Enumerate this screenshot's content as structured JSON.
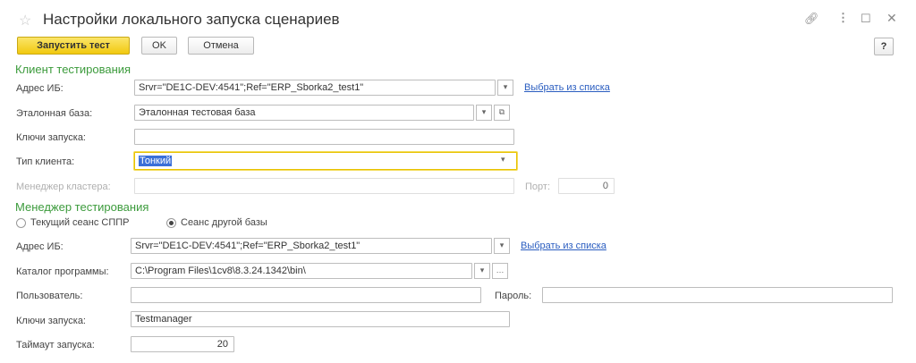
{
  "window": {
    "title": "Настройки локального запуска сценариев",
    "help_label": "?"
  },
  "toolbar": {
    "run_label": "Запустить тест",
    "ok_label": "OK",
    "cancel_label": "Отмена"
  },
  "client": {
    "section_title": "Клиент тестирования",
    "ib_address_label": "Адрес ИБ:",
    "ib_address_value": "Srvr=\"DE1C-DEV:4541\";Ref=\"ERP_Sborka2_test1\"",
    "select_from_list": "Выбрать из списка",
    "reference_base_label": "Эталонная база:",
    "reference_base_value": "Эталонная тестовая база",
    "launch_keys_label": "Ключи запуска:",
    "launch_keys_value": "",
    "client_type_label": "Тип клиента:",
    "client_type_value": "Тонкий",
    "cluster_manager_label": "Менеджер кластера:",
    "cluster_manager_value": "",
    "port_label": "Порт:",
    "port_value": "0"
  },
  "manager": {
    "section_title": "Менеджер тестирования",
    "radio_current": "Текущий сеанс СППР",
    "radio_other": "Сеанс другой базы",
    "ib_address_label": "Адрес ИБ:",
    "ib_address_value": "Srvr=\"DE1C-DEV:4541\";Ref=\"ERP_Sborka2_test1\"",
    "select_from_list": "Выбрать из списка",
    "program_dir_label": "Каталог программы:",
    "program_dir_value": "C:\\Program Files\\1cv8\\8.3.24.1342\\bin\\",
    "user_label": "Пользователь:",
    "user_value": "",
    "password_label": "Пароль:",
    "password_value": "",
    "launch_keys_label": "Ключи запуска:",
    "launch_keys_value": "Testmanager",
    "timeout_label": "Таймаут запуска:",
    "timeout_value": "20"
  }
}
